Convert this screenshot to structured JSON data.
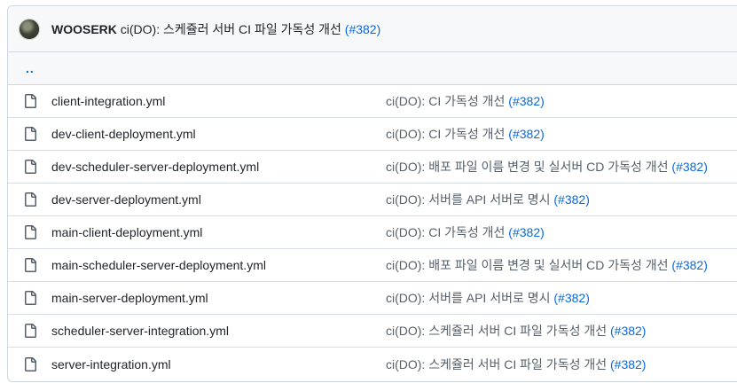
{
  "header": {
    "author": "WOOSERK",
    "message": "ci(DO): 스케쥴러 서버 CI 파일 가독성 개선",
    "pr": "(#382)"
  },
  "parent_link": "..",
  "icons": {
    "file": "file-icon"
  },
  "colors": {
    "link": "#0969da",
    "border": "#d0d7de",
    "header_bg": "#f6f8fa"
  },
  "files": [
    {
      "name": "client-integration.yml",
      "message": "ci(DO): CI 가독성 개선 ",
      "pr": "(#382)"
    },
    {
      "name": "dev-client-deployment.yml",
      "message": "ci(DO): CI 가독성 개선 ",
      "pr": "(#382)"
    },
    {
      "name": "dev-scheduler-server-deployment.yml",
      "message": "ci(DO): 배포 파일 이름 변경 및 실서버 CD 가독성 개선 ",
      "pr": "(#382)"
    },
    {
      "name": "dev-server-deployment.yml",
      "message": "ci(DO): 서버를 API 서버로 명시 ",
      "pr": "(#382)"
    },
    {
      "name": "main-client-deployment.yml",
      "message": "ci(DO): CI 가독성 개선 ",
      "pr": "(#382)"
    },
    {
      "name": "main-scheduler-server-deployment.yml",
      "message": "ci(DO): 배포 파일 이름 변경 및 실서버 CD 가독성 개선 ",
      "pr": "(#382)"
    },
    {
      "name": "main-server-deployment.yml",
      "message": "ci(DO): 서버를 API 서버로 명시 ",
      "pr": "(#382)"
    },
    {
      "name": "scheduler-server-integration.yml",
      "message": "ci(DO): 스케쥴러 서버 CI 파일 가독성 개선 ",
      "pr": "(#382)"
    },
    {
      "name": "server-integration.yml",
      "message": "ci(DO): 스케쥴러 서버 CI 파일 가독성 개선 ",
      "pr": "(#382)"
    }
  ]
}
